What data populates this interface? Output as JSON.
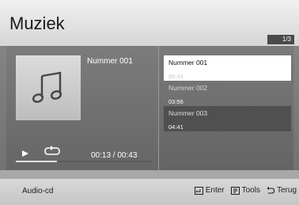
{
  "header": {
    "title": "Muziek",
    "page_indicator": "1/3"
  },
  "now_playing": {
    "track_name": "Nummer 001",
    "time": "00:13 / 00:43",
    "progress_fraction": 0.3
  },
  "playlist": [
    {
      "name": "Nummer 001",
      "duration": "00:43",
      "state": "selected"
    },
    {
      "name": "Nummer 002",
      "duration": "03:56",
      "state": "normal"
    },
    {
      "name": "Nummer 003",
      "duration": "04:41",
      "state": "highlighted"
    }
  ],
  "footer": {
    "source_label": "Audio-cd",
    "buttons": [
      {
        "label": "Enter",
        "icon": "enter-icon"
      },
      {
        "label": "Tools",
        "icon": "tools-icon"
      },
      {
        "label": "Terug",
        "icon": "return-icon"
      }
    ]
  },
  "icons": {
    "album_art": "music-note-icon",
    "play": "play-icon",
    "repeat": "repeat-icon"
  }
}
